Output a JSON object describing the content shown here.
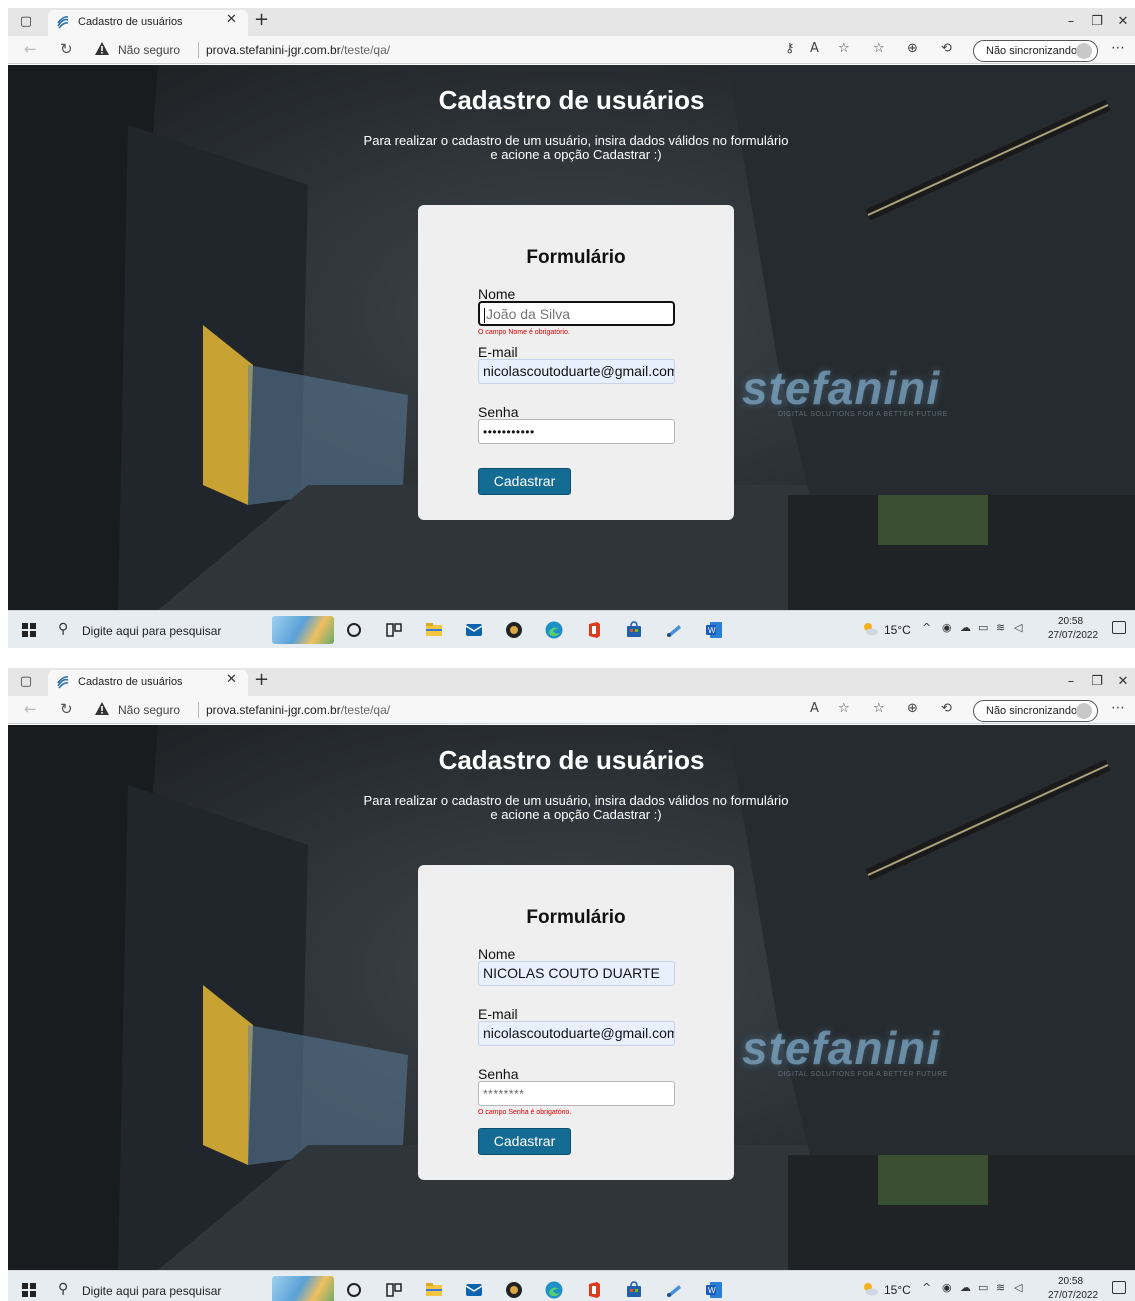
{
  "browser": {
    "tab_title": "Cadastro de usuários",
    "insecure_label": "Não seguro",
    "url_host": "prova.stefanini-jgr.com.br",
    "url_path": "/teste/qa/",
    "sync_label": "Não sincronizando"
  },
  "page": {
    "title": "Cadastro de usuários",
    "subtitle_line1": "Para realizar o cadastro de um usuário, insira dados válidos no formulário",
    "subtitle_line2": "e acione a opção Cadastrar :)",
    "background_logo": "stefanini",
    "background_tagline": "DIGITAL SOLUTIONS FOR A BETTER FUTURE"
  },
  "form": {
    "title": "Formulário",
    "name_label": "Nome",
    "email_label": "E-mail",
    "password_label": "Senha",
    "submit_label": "Cadastrar"
  },
  "screenshots": [
    {
      "name_placeholder": "João da Silva",
      "name_value": "",
      "name_error": "O campo Nome é obrigatório.",
      "email_value": "nicolascoutoduarte@gmail.com",
      "password_mask": "•••••••••••",
      "password_error": ""
    },
    {
      "name_placeholder": "",
      "name_value": "NICOLAS COUTO DUARTE",
      "name_error": "",
      "email_value": "nicolascoutoduarte@gmail.com",
      "password_mask": "********",
      "password_error": "O campo Senha é obrigatório."
    }
  ],
  "taskbar": {
    "search_placeholder": "Digite aqui para pesquisar",
    "temperature": "15°C",
    "time": "20:58",
    "date": "27/07/2022"
  },
  "colors": {
    "button": "#146c94",
    "error": "#e00000",
    "card": "#efefef",
    "autofill": "#e8f0fe"
  }
}
